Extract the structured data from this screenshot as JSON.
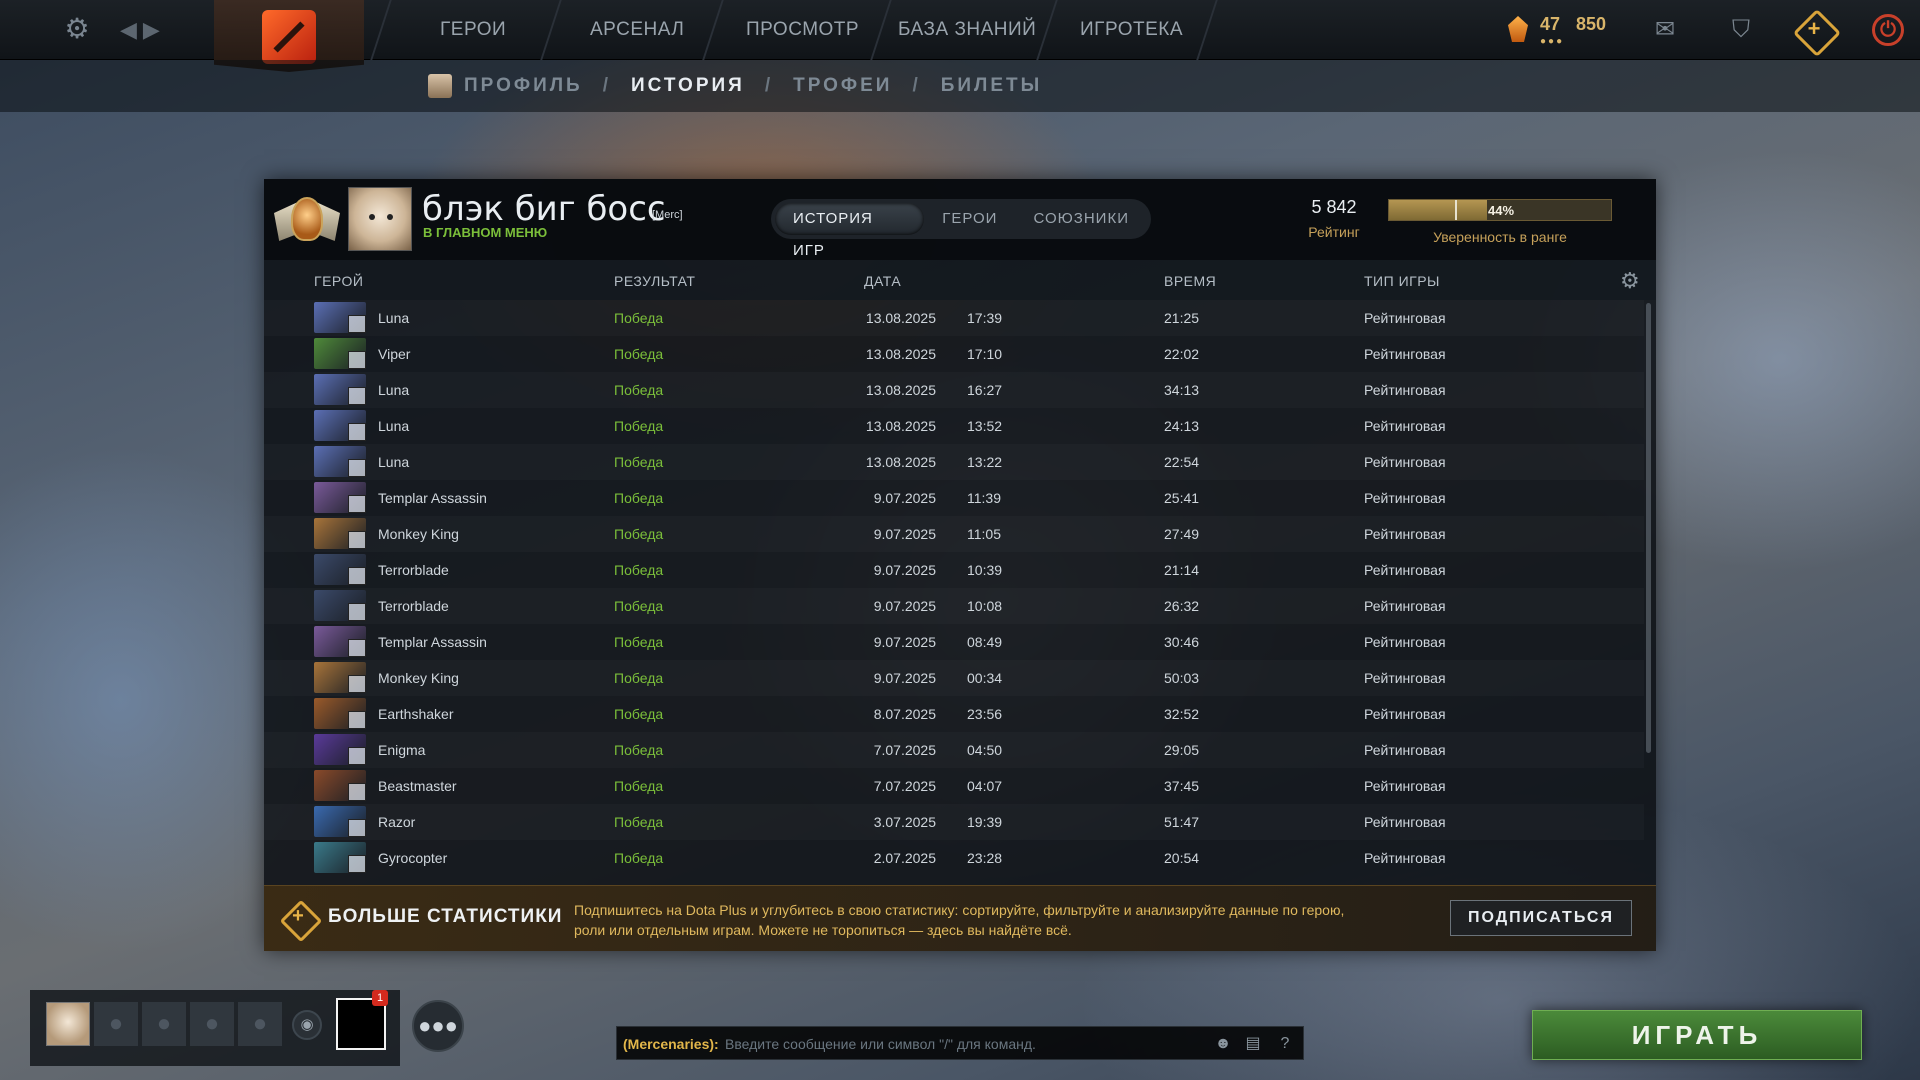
{
  "topbar": {
    "nav": [
      "ГЕРОИ",
      "АРСЕНАЛ",
      "ПРОСМОТР",
      "БАЗА ЗНАНИЙ",
      "ИГРОТЕКА"
    ],
    "level": "47",
    "points": "850"
  },
  "subnav": {
    "items": [
      "ПРОФИЛЬ",
      "ИСТОРИЯ",
      "ТРОФЕИ",
      "БИЛЕТЫ"
    ],
    "separator": "/",
    "active": "ИСТОРИЯ"
  },
  "profile": {
    "name": "блэк биг босс",
    "tag": "[Merc]",
    "status": "В ГЛАВНОМ МЕНЮ",
    "rating_value": "5 842",
    "rating_label": "Рейтинг",
    "confidence_pct": "44%",
    "confidence_value": 44,
    "confidence_label": "Уверенность в ранге"
  },
  "tabs": [
    "ИСТОРИЯ ИГР",
    "ГЕРОИ",
    "СОЮЗНИКИ"
  ],
  "columns": {
    "hero": "ГЕРОЙ",
    "result": "РЕЗУЛЬТАТ",
    "date": "ДАТА",
    "duration": "ВРЕМЯ",
    "type": "ТИП ИГРЫ"
  },
  "matches": [
    {
      "hero": "Luna",
      "result": "Победа",
      "date": "13.08.2025",
      "time": "17:39",
      "duration": "21:25",
      "type": "Рейтинговая",
      "color": "#5b6fb5"
    },
    {
      "hero": "Viper",
      "result": "Победа",
      "date": "13.08.2025",
      "time": "17:10",
      "duration": "22:02",
      "type": "Рейтинговая",
      "color": "#4f8a3a"
    },
    {
      "hero": "Luna",
      "result": "Победа",
      "date": "13.08.2025",
      "time": "16:27",
      "duration": "34:13",
      "type": "Рейтинговая",
      "color": "#5b6fb5"
    },
    {
      "hero": "Luna",
      "result": "Победа",
      "date": "13.08.2025",
      "time": "13:52",
      "duration": "24:13",
      "type": "Рейтинговая",
      "color": "#5b6fb5"
    },
    {
      "hero": "Luna",
      "result": "Победа",
      "date": "13.08.2025",
      "time": "13:22",
      "duration": "22:54",
      "type": "Рейтинговая",
      "color": "#5b6fb5"
    },
    {
      "hero": "Templar Assassin",
      "result": "Победа",
      "date": "9.07.2025",
      "time": "11:39",
      "duration": "25:41",
      "type": "Рейтинговая",
      "color": "#7a5a9a"
    },
    {
      "hero": "Monkey King",
      "result": "Победа",
      "date": "9.07.2025",
      "time": "11:05",
      "duration": "27:49",
      "type": "Рейтинговая",
      "color": "#a8743a"
    },
    {
      "hero": "Terrorblade",
      "result": "Победа",
      "date": "9.07.2025",
      "time": "10:39",
      "duration": "21:14",
      "type": "Рейтинговая",
      "color": "#3b4a6a"
    },
    {
      "hero": "Terrorblade",
      "result": "Победа",
      "date": "9.07.2025",
      "time": "10:08",
      "duration": "26:32",
      "type": "Рейтинговая",
      "color": "#3b4a6a"
    },
    {
      "hero": "Templar Assassin",
      "result": "Победа",
      "date": "9.07.2025",
      "time": "08:49",
      "duration": "30:46",
      "type": "Рейтинговая",
      "color": "#7a5a9a"
    },
    {
      "hero": "Monkey King",
      "result": "Победа",
      "date": "9.07.2025",
      "time": "00:34",
      "duration": "50:03",
      "type": "Рейтинговая",
      "color": "#a8743a"
    },
    {
      "hero": "Earthshaker",
      "result": "Победа",
      "date": "8.07.2025",
      "time": "23:56",
      "duration": "32:52",
      "type": "Рейтинговая",
      "color": "#9a5a2a"
    },
    {
      "hero": "Enigma",
      "result": "Победа",
      "date": "7.07.2025",
      "time": "04:50",
      "duration": "29:05",
      "type": "Рейтинговая",
      "color": "#5a3a9a"
    },
    {
      "hero": "Beastmaster",
      "result": "Победа",
      "date": "7.07.2025",
      "time": "04:07",
      "duration": "37:45",
      "type": "Рейтинговая",
      "color": "#8a4a2a"
    },
    {
      "hero": "Razor",
      "result": "Победа",
      "date": "3.07.2025",
      "time": "19:39",
      "duration": "51:47",
      "type": "Рейтинговая",
      "color": "#3a6ab0"
    },
    {
      "hero": "Gyrocopter",
      "result": "Победа",
      "date": "2.07.2025",
      "time": "23:28",
      "duration": "20:54",
      "type": "Рейтинговая",
      "color": "#3a7a8a"
    }
  ],
  "promo": {
    "title": "БОЛЬШЕ СТАТИСТИКИ",
    "text": "Подпишитесь на Dota Plus и углубитесь в свою статистику: сортируйте, фильтруйте и анализируйте данные по герою, роли или отдельным играм. Можете не торопиться — здесь вы найдёте всё.",
    "button": "ПОДПИСАТЬСЯ"
  },
  "party": {
    "notification_count": "1"
  },
  "chat": {
    "channel": "(Mercenaries):",
    "placeholder": "Введите сообщение или символ \"/\" для команд."
  },
  "play_button": "ИГРАТЬ"
}
